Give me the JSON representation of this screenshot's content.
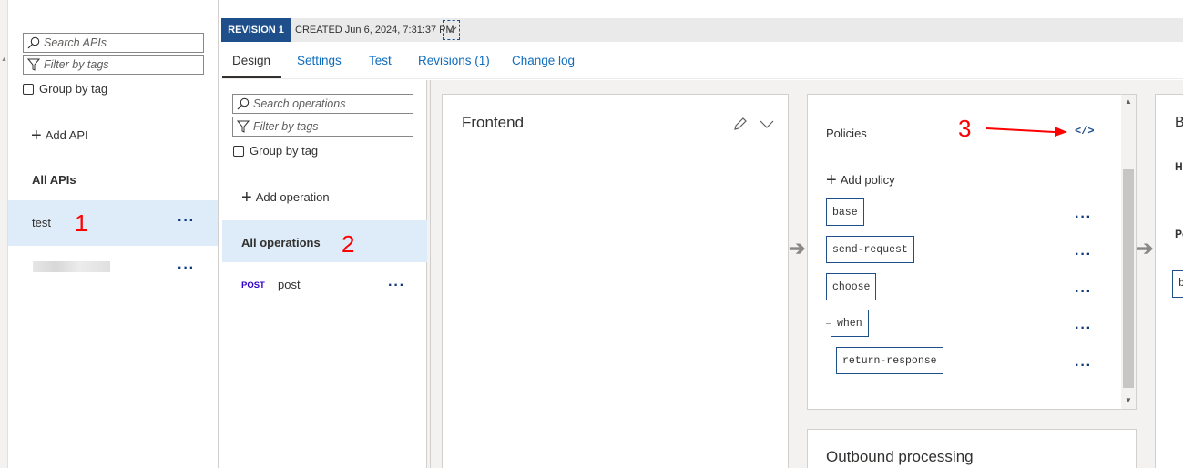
{
  "apis_panel": {
    "search_placeholder": "Search APIs",
    "filter_placeholder": "Filter by tags",
    "group_by_tag": "Group by tag",
    "add_api": "Add API",
    "section_title": "All APIs",
    "items": [
      {
        "name": "test",
        "selected": true
      },
      {
        "name": "",
        "selected": false,
        "redacted": true
      }
    ]
  },
  "revision": {
    "badge": "REVISION 1",
    "created": "CREATED Jun 6, 2024, 7:31:37 PM"
  },
  "tabs": [
    "Design",
    "Settings",
    "Test",
    "Revisions (1)",
    "Change log"
  ],
  "active_tab": "Design",
  "operations_panel": {
    "search_placeholder": "Search operations",
    "filter_placeholder": "Filter by tags",
    "group_by_tag": "Group by tag",
    "add_operation": "Add operation",
    "all_operations": "All operations",
    "operations": [
      {
        "method": "POST",
        "name": "post"
      }
    ]
  },
  "frontend": {
    "title": "Frontend"
  },
  "policies": {
    "title": "Policies",
    "add_policy": "Add policy",
    "items": [
      "base",
      "send-request",
      "choose",
      "when",
      "return-response"
    ]
  },
  "outbound": {
    "title": "Outbound processing"
  },
  "backend_partial": {
    "title_letter": "B",
    "label_h": "H",
    "label_p": "Pc",
    "tag_letter": "b"
  },
  "annotations": [
    "1",
    "2",
    "3"
  ],
  "colors": {
    "accent": "#0f6cbd",
    "badge_bg": "#1e4f8a",
    "selected_bg": "#deecf9",
    "annotation_red": "#ff0000",
    "post_method": "#3300cc"
  },
  "icons": {
    "search": "search-icon",
    "filter": "filter-icon",
    "add": "plus-icon",
    "more": "more-dots-icon",
    "edit": "pencil-icon",
    "expand": "chevron-down-icon",
    "code": "code-view-icon",
    "flow": "arrow-right-icon"
  }
}
